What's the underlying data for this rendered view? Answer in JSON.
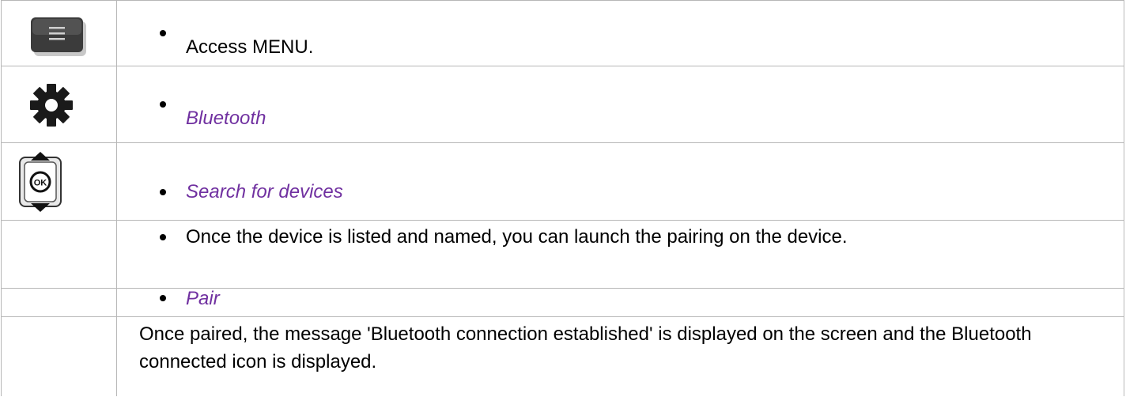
{
  "rows": [
    {
      "icon": "menu-button-icon",
      "text": "Access MENU."
    },
    {
      "icon": "gear-icon",
      "text": "Bluetooth"
    },
    {
      "icon": "ok-navigator-icon",
      "text": "Search for devices"
    },
    {
      "icon": "",
      "text": "Once the device is listed and named, you can launch the pairing on the device."
    },
    {
      "icon": "",
      "text": "Pair"
    },
    {
      "icon": "",
      "text": "Once paired, the message 'Bluetooth connection established' is displayed on the screen and the Bluetooth connected icon is displayed."
    }
  ],
  "colors": {
    "option_text": "#7030a0",
    "border": "#b7b7b7"
  }
}
